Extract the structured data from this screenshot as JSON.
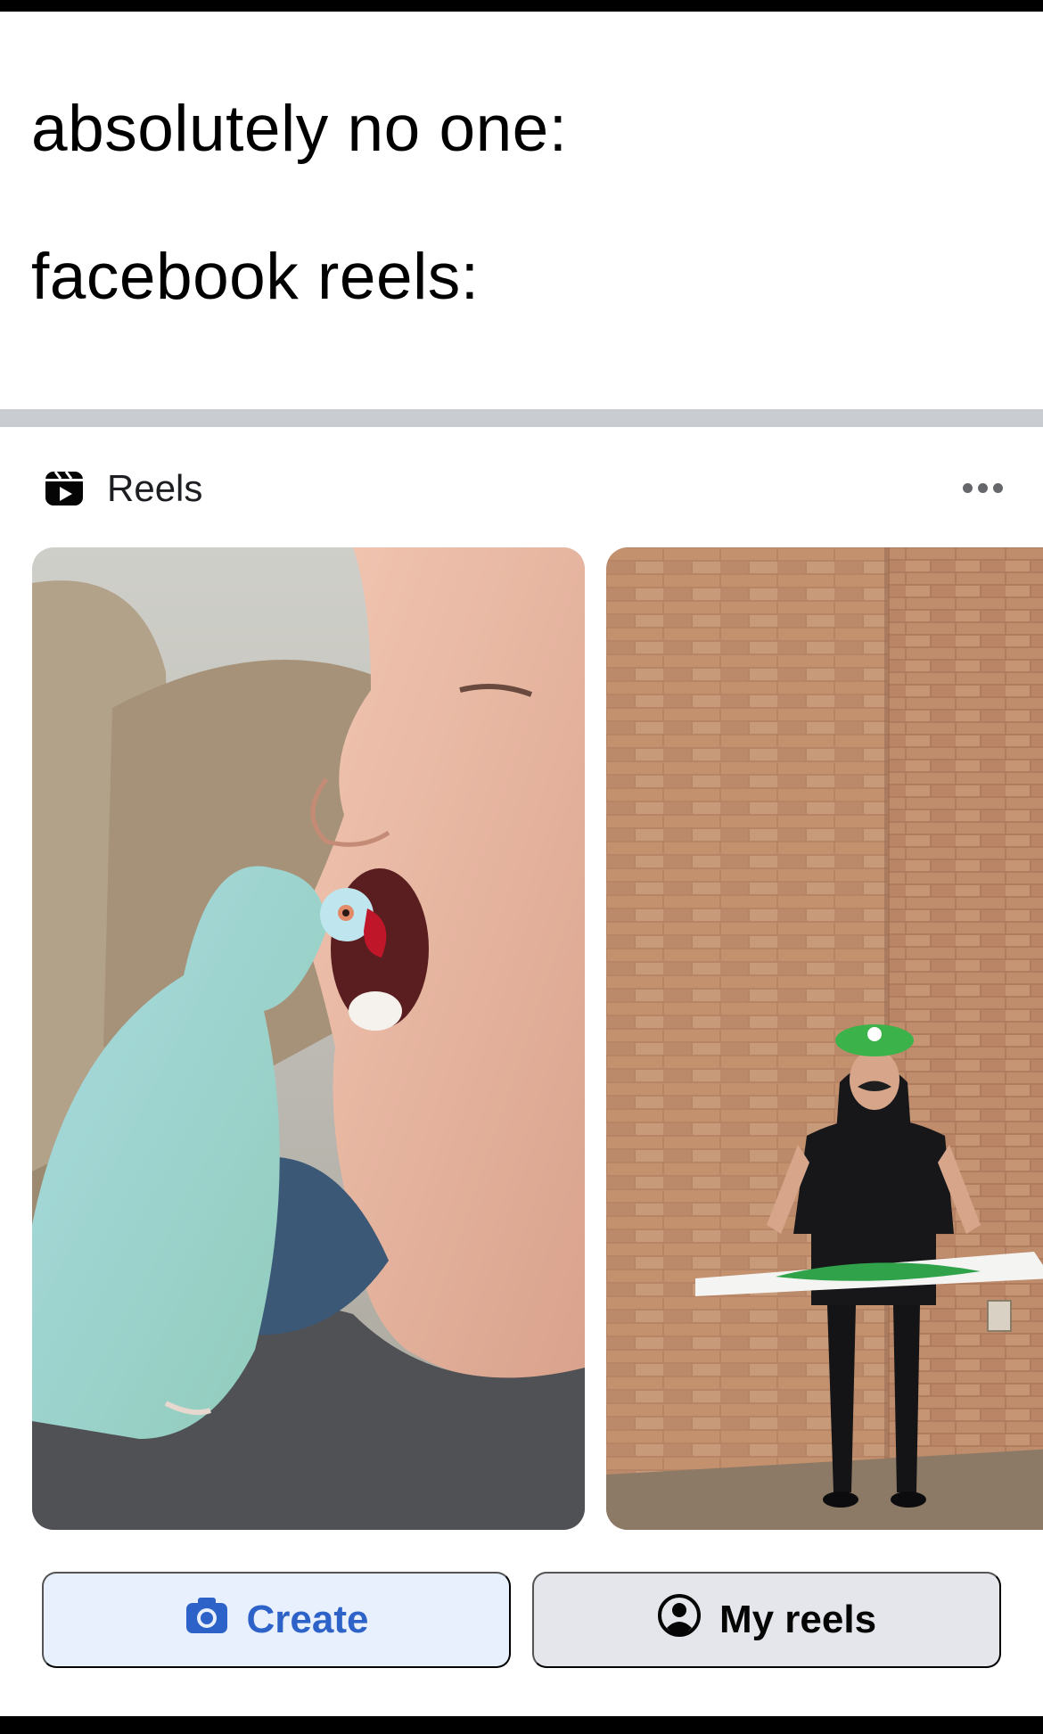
{
  "meme": {
    "line1": "absolutely no one:",
    "line2": "facebook reels:"
  },
  "reels_section": {
    "title": "Reels",
    "header_icon": "reels-icon",
    "more_icon": "more-options-icon",
    "thumbnails": [
      {
        "subject": "parrot-with-woman-thumbnail"
      },
      {
        "subject": "luigi-costume-thumbnail"
      }
    ],
    "buttons": {
      "create_label": "Create",
      "create_icon": "camera-icon",
      "my_reels_label": "My reels",
      "my_reels_icon": "profile-icon"
    }
  },
  "colors": {
    "divider": "#c9ccd1",
    "create_bg": "#e7f0fc",
    "create_fg": "#2d63c8",
    "my_reels_bg": "#e4e6eb",
    "text_primary": "#050505",
    "icon_gray": "#65676b"
  }
}
